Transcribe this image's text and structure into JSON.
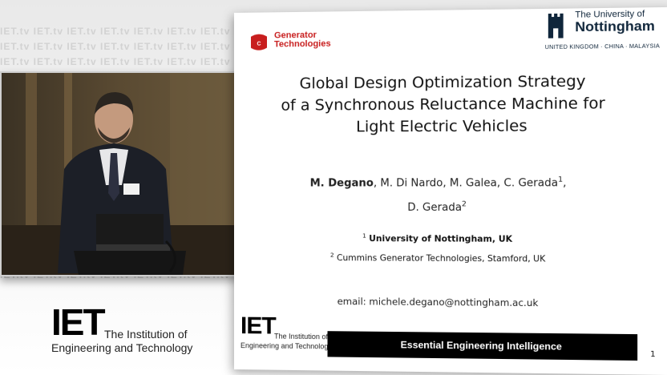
{
  "watermark": {
    "text": "IET.tv IET.tv IET.tv IET.tv IET.tv IET.tv IET.tv"
  },
  "logo": {
    "word": "IET",
    "institution": "The Institution of",
    "subtitle": "Engineering and Technology"
  },
  "slide": {
    "sponsor": {
      "line1": "Generator",
      "line2": "Technologies"
    },
    "university": {
      "the": "The University of",
      "name": "Nottingham",
      "locations": "UNITED KINGDOM · CHINA · MALAYSIA"
    },
    "title_lines": [
      "Global Design Optimization Strategy",
      "of a Synchronous Reluctance Machine for",
      "Light Electric Vehicles"
    ],
    "authors": {
      "lead": "M. Degano",
      "rest": ", M. Di Nardo, M. Galea, C. Gerada",
      "sup1": "1",
      "line2": "D. Gerada",
      "sup2": "2"
    },
    "affiliations": [
      {
        "sup": "1",
        "text": "University of Nottingham, UK"
      },
      {
        "sup": "2",
        "text": "Cummins Generator Technologies, Stamford, UK"
      }
    ],
    "email": "email: michele.degano@nottingham.ac.uk",
    "footer_logo": {
      "word": "IET",
      "institution": "The Institution of",
      "subtitle": "Engineering and Technology"
    },
    "footer_bar": "Essential Engineering Intelligence",
    "page_number": "1"
  }
}
